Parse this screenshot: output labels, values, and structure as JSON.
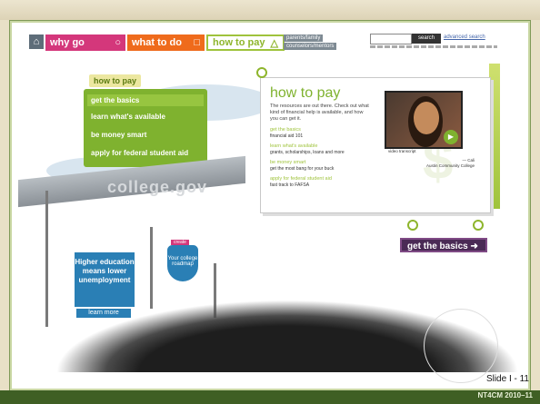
{
  "nav": {
    "home_icon": "home-icon",
    "tabs": [
      {
        "label": "why go",
        "icon": "circle-icon",
        "color": "#d4377b"
      },
      {
        "label": "what to do",
        "icon": "square-icon",
        "color": "#ef6b1c"
      },
      {
        "label": "how to pay",
        "icon": "triangle-icon",
        "color": "#9fc33c"
      }
    ],
    "mini_links": [
      "parents/family",
      "counselors/mentors"
    ],
    "search_label": "search",
    "advanced_search": "advanced search"
  },
  "left_menu": {
    "header": "how to pay",
    "items": [
      "get the basics",
      "learn what's available",
      "be money smart",
      "apply for federal student aid"
    ],
    "active_index": 0
  },
  "scenery": {
    "watermark": "college.gov",
    "blue_sign": "Higher education means lower unemployment",
    "learn_more": "learn more",
    "shield_tag": "create",
    "shield_text": "Your college roadmap"
  },
  "billboard": {
    "title": "how to pay",
    "intro": "The resources are out there. Check out what kind of financial help is available, and how you can get it.",
    "links": [
      {
        "label": "get the basics",
        "sub": "financial aid 101"
      },
      {
        "label": "learn what's available",
        "sub": "grants, scholarships, loans and more"
      },
      {
        "label": "be money smart",
        "sub": "get the most bang for your buck"
      },
      {
        "label": "apply for federal student aid",
        "sub": "fast track to FAFSA"
      }
    ],
    "video_play": "click to play",
    "video_note": "video transcript",
    "quote_name": "— Cali",
    "quote_school": "Austin Community College"
  },
  "cta": {
    "label": "get the basics"
  },
  "slide": {
    "number": "Slide I - 11",
    "footer": "NT4CM 2010–11"
  }
}
